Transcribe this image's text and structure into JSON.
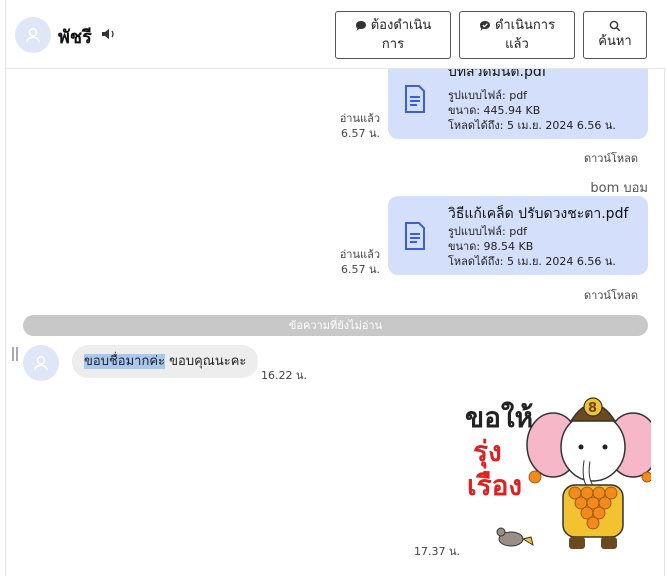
{
  "header": {
    "contact_name": "พัชรี",
    "buttons": {
      "pending_line1": "ต้องดำเนิน",
      "pending_line2": "การ",
      "done_line1": "ดำเนินการ",
      "done_line2": "แล้ว",
      "search": "ค้นหา"
    }
  },
  "messages": [
    {
      "type": "file",
      "file_name": "บทสวดมนต์.pdf",
      "file_type": "รูปแบบไฟล์: pdf",
      "size": "ขนาด: 445.94 KB",
      "available_until": "โหลดได้ถึง: 5 เม.ย. 2024 6.56 น.",
      "read_label": "อ่านแล้ว",
      "time": "6.57 น.",
      "download": "ดาวน์โหลด"
    },
    {
      "type": "file",
      "sender": "bom บอม",
      "file_name": "วิธีแก้เคล็ด ปรับดวงชะตา.pdf",
      "file_type": "รูปแบบไฟล์: pdf",
      "size": "ขนาด: 98.54 KB",
      "available_until": "โหลดได้ถึง: 5 เม.ย. 2024 6.56 น.",
      "read_label": "อ่านแล้ว",
      "time": "6.57 น.",
      "download": "ดาวน์โหลด"
    }
  ],
  "unread_divider": "ข้อความที่ยังไม่อ่าน",
  "incoming": {
    "text_highlighted": "ขอบชื่อมากค่ะ",
    "text_rest": " ขอบคุณนะคะ",
    "time": "16.22 น."
  },
  "sticker": {
    "caption_line1": "ขอให้",
    "caption_line2": "รุ่ง",
    "caption_line3": "เรือง",
    "badge_number": "8",
    "time": "17.37 น."
  },
  "colors": {
    "file_bubble": "#d4dffb",
    "avatar_bg": "#dfe6f8",
    "divider": "#c8c8c8",
    "incoming_bubble": "#ededed",
    "caption_red": "#e02020"
  }
}
